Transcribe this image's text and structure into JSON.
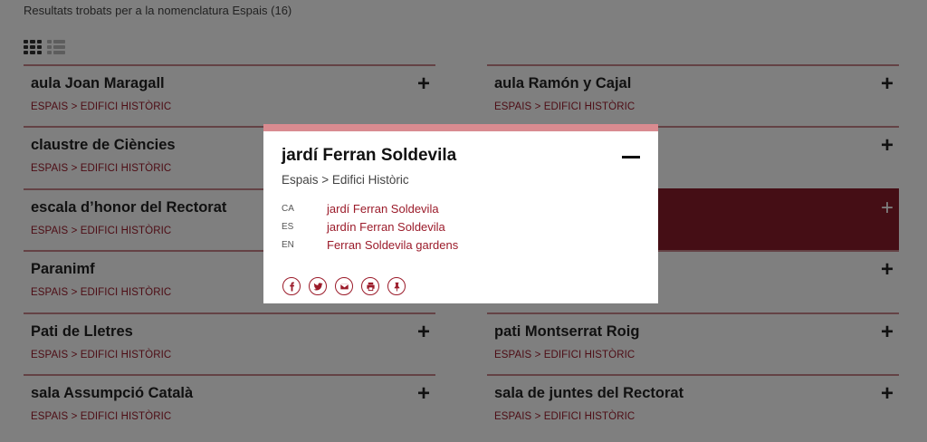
{
  "results_header": "Resultats trobats per a la nomenclatura Espais (16)",
  "left_items": [
    {
      "title": "aula Joan Maragall",
      "path": "ESPAIS > EDIFICI HISTÒRIC"
    },
    {
      "title": "claustre de Ciències",
      "path": "ESPAIS > EDIFICI HISTÒRIC"
    },
    {
      "title": "escala d’honor del Rectorat",
      "path": "ESPAIS > EDIFICI HISTÒRIC"
    },
    {
      "title": "Paranimf",
      "path": "ESPAIS > EDIFICI HISTÒRIC"
    },
    {
      "title": "Pati de Lletres",
      "path": "ESPAIS > EDIFICI HISTÒRIC"
    },
    {
      "title": "sala Assumpció Català",
      "path": "ESPAIS > EDIFICI HISTÒRIC"
    }
  ],
  "right_items": [
    {
      "title": "aula Ramón y Cajal",
      "path": "ESPAIS > EDIFICI HISTÒRIC"
    },
    {
      "title": "",
      "path": ""
    },
    {
      "title": "",
      "path": ""
    },
    {
      "title": "",
      "path": ""
    },
    {
      "title": "pati Montserrat Roig",
      "path": "ESPAIS > EDIFICI HISTÒRIC"
    },
    {
      "title": "sala de juntes del Rectorat",
      "path": "ESPAIS > EDIFICI HISTÒRIC"
    }
  ],
  "modal": {
    "title": "jardí Ferran Soldevila",
    "path": "Espais > Edifici Històric",
    "translations": [
      {
        "code": "CA",
        "value": "jardí Ferran Soldevila"
      },
      {
        "code": "ES",
        "value": "jardín Ferran Soldevila"
      },
      {
        "code": "EN",
        "value": "Ferran Soldevila gardens"
      }
    ]
  },
  "colors": {
    "accent": "#9b1b2a",
    "active": "#8a1d2b",
    "modal_bar": "#d98b90"
  },
  "icons": {
    "expand": "plus-icon",
    "collapse": "minus-icon",
    "share": [
      "facebook-icon",
      "twitter-icon",
      "email-icon",
      "print-icon",
      "pin-icon"
    ]
  }
}
